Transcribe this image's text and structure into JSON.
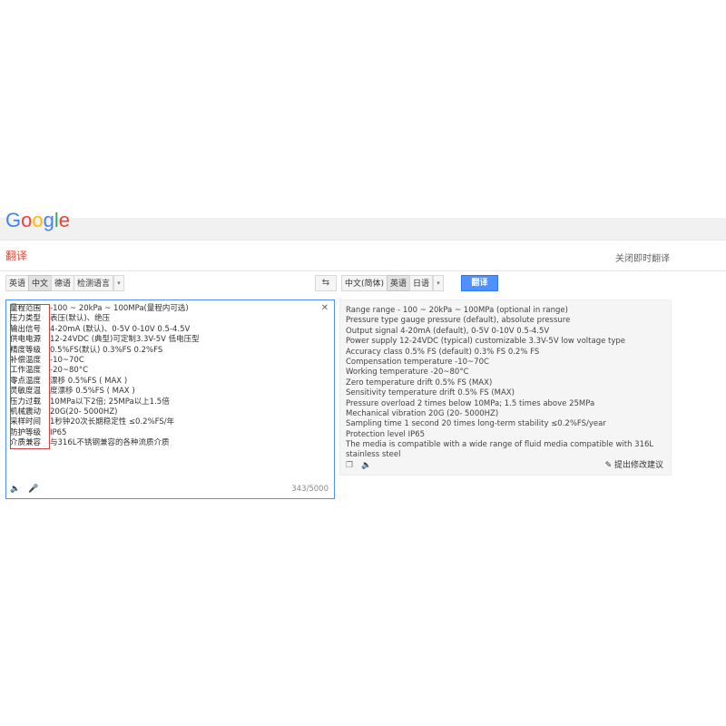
{
  "header": {
    "logo_letters": [
      {
        "ch": "G",
        "color": "#4285f4"
      },
      {
        "ch": "o",
        "color": "#ea4335"
      },
      {
        "ch": "o",
        "color": "#fbbc05"
      },
      {
        "ch": "g",
        "color": "#4285f4"
      },
      {
        "ch": "l",
        "color": "#34a853"
      },
      {
        "ch": "e",
        "color": "#ea4335"
      }
    ],
    "page_title": "翻译",
    "top_link": "关闭即时翻译"
  },
  "source": {
    "lang_buttons": [
      "英语",
      "中文",
      "德语",
      "检测语言"
    ],
    "active_lang": "中文",
    "lines": [
      {
        "label": "量程范围",
        "value": "-100 ~ 20kPa ~ 100MPa(量程内可选)"
      },
      {
        "label": "压力类型",
        "value": "表压(默认)、绝压"
      },
      {
        "label": "输出信号",
        "value": "4-20mA (默认)、0-5V 0-10V 0.5-4.5V"
      },
      {
        "label": "供电电源",
        "value": "12-24VDC (典型)可定制3.3V-5V 低电压型"
      },
      {
        "label": "精度等级",
        "value": "0.5%FS(默认) 0.3%FS 0.2%FS"
      },
      {
        "label": "补偿温度",
        "value": "-10~70C"
      },
      {
        "label": "工作温度",
        "value": "-20~80°C"
      },
      {
        "label": "零点温度",
        "value": "漂移  0.5%FS ( MAX )"
      },
      {
        "label": "灵敏度温",
        "value": "度漂移  0.5%FS ( MAX )"
      },
      {
        "label": "压力过载",
        "value": "10MPa以下2倍; 25MPa以上1.5倍"
      },
      {
        "label": "机械震动",
        "value": "20G(20- 5000HZ)"
      },
      {
        "label": "采样时间",
        "value": "1秒钟20次长期稳定性  ≤0.2%FS/年"
      },
      {
        "label": "防护等级",
        "value": "IP65"
      },
      {
        "label": "介质兼容",
        "value": "与316L不锈钢兼容的各种流质介质"
      }
    ],
    "clear_icon": "close-icon",
    "char_count": "343/5000"
  },
  "target": {
    "lang_buttons": [
      "中文(简体)",
      "英语",
      "日语"
    ],
    "active_lang": "英语",
    "translate_label": "翻译",
    "lines": [
      "Range range - 100 ~ 20kPa ~ 100MPa (optional in range)",
      "Pressure type gauge pressure (default), absolute pressure",
      "Output signal 4-20mA (default), 0-5V 0-10V 0.5-4.5V",
      "Power supply 12-24VDC (typical) customizable 3.3V-5V low voltage type",
      "Accuracy class 0.5% FS (default) 0.3% FS 0.2% FS",
      "Compensation temperature -10~70C",
      "Working temperature -20~80°C",
      "Zero temperature drift 0.5% FS (MAX)",
      "Sensitivity temperature drift 0.5% FS (MAX)",
      "Pressure overload 2 times below 10MPa; 1.5 times above 25MPa",
      "Mechanical vibration 20G (20- 5000HZ)",
      "Sampling time 1 second 20 times long-term stability ≤0.2%FS/year",
      "Protection level IP65",
      "The media is compatible with a wide range of fluid media compatible with 316L",
      "stainless steel"
    ],
    "suggest_label": "提出修改建议"
  },
  "swap_icon": "swap-arrows-icon",
  "colors": {
    "accent": "#4d90fe",
    "title": "#dd4b39"
  }
}
